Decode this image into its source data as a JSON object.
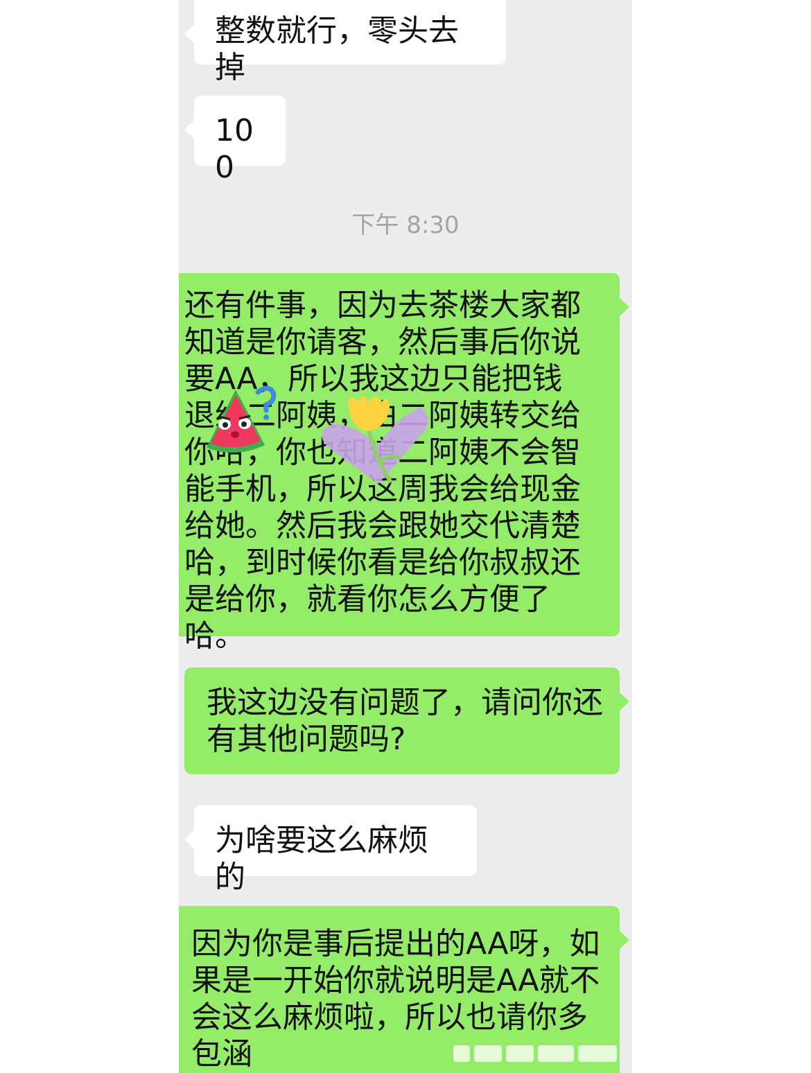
{
  "chat": {
    "messages": [
      {
        "side": "received",
        "text": "整数就行，零头去掉"
      },
      {
        "side": "received",
        "text": "100"
      },
      {
        "side": "sent",
        "text": "还有件事，因为去茶楼大家都知道是你请客，然后事后你说要AA，所以我这边只能把钱退给二阿姨，由二阿姨转交给你哈，你也知道二阿姨不会智能手机，所以这周我会给现金给她。然后我会跟她交代清楚哈，到时候你看是给你叔叔还是给你，就看你怎么方便了哈。"
      },
      {
        "side": "sent",
        "text": "我这边没有问题了，请问你还有其他问题吗?"
      },
      {
        "side": "received",
        "text": "为啥要这么麻烦的"
      },
      {
        "side": "sent",
        "text": "因为你是事后提出的AA呀，如果是一开始你就说明是AA就不会这么麻烦啦，所以也请你多包涵"
      }
    ],
    "timestamp": "下午 8:30"
  },
  "stickers": [
    {
      "name": "watermelon-question-sticker",
      "icon": "watermelon-face-with-question-mark",
      "colors": {
        "flesh": "#ef3a5d",
        "rind": "#3fae4b",
        "mark": "#3b8de0"
      }
    },
    {
      "name": "tulip-heart-sticker",
      "icon": "yellow-tulip-with-purple-heart",
      "colors": {
        "petal": "#ffd23f",
        "heart": "#c9a4ea",
        "stem": "#8fcf6a"
      }
    }
  ],
  "theme": {
    "panel_bg": "#ededed",
    "sent_bubble": "#95ec69",
    "received_bubble": "#ffffff",
    "timestamp_color": "#a4a4a4"
  }
}
